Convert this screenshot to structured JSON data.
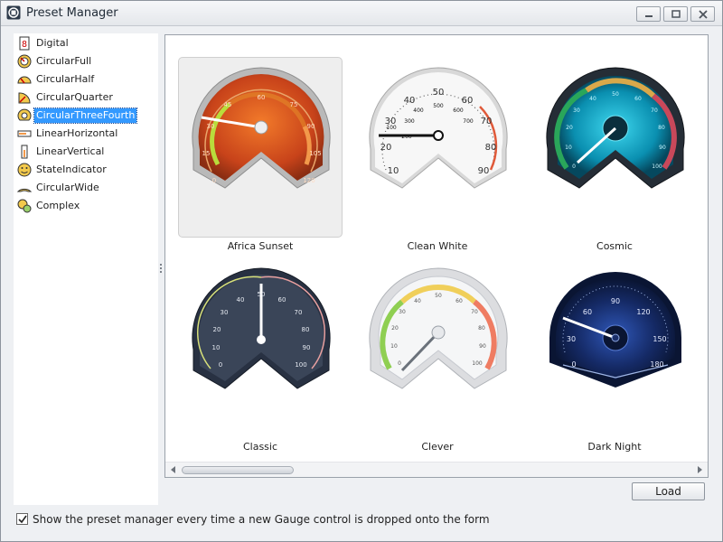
{
  "window": {
    "title": "Preset Manager"
  },
  "tree": {
    "selected": "CircularThreeFourth",
    "items": [
      {
        "label": "Digital",
        "icon": "digital-icon"
      },
      {
        "label": "CircularFull",
        "icon": "circular-full-icon"
      },
      {
        "label": "CircularHalf",
        "icon": "circular-half-icon"
      },
      {
        "label": "CircularQuarter",
        "icon": "circular-quarter-icon"
      },
      {
        "label": "CircularThreeFourth",
        "icon": "circular-three-fourth-icon"
      },
      {
        "label": "LinearHorizontal",
        "icon": "linear-horizontal-icon"
      },
      {
        "label": "LinearVertical",
        "icon": "linear-vertical-icon"
      },
      {
        "label": "StateIndicator",
        "icon": "state-indicator-icon"
      },
      {
        "label": "CircularWide",
        "icon": "circular-wide-icon"
      },
      {
        "label": "Complex",
        "icon": "complex-icon"
      }
    ]
  },
  "gallery": {
    "selected": "Africa Sunset",
    "presets": [
      {
        "name": "Africa Sunset",
        "scale": [
          "0",
          "15",
          "30",
          "45",
          "60",
          "75",
          "90",
          "105",
          "120"
        ]
      },
      {
        "name": "Clean White",
        "scale": [
          "10",
          "20",
          "30",
          "40",
          "50",
          "60",
          "70",
          "80",
          "90"
        ],
        "inner_scale": [
          "100",
          "200",
          "300",
          "400",
          "500",
          "600",
          "700"
        ]
      },
      {
        "name": "Cosmic",
        "scale": [
          "0",
          "10",
          "20",
          "30",
          "40",
          "50",
          "60",
          "70",
          "80",
          "90",
          "100"
        ]
      },
      {
        "name": "Classic",
        "scale": [
          "0",
          "10",
          "20",
          "30",
          "40",
          "50",
          "60",
          "70",
          "80",
          "90",
          "100"
        ]
      },
      {
        "name": "Clever",
        "scale": [
          "0",
          "10",
          "20",
          "30",
          "40",
          "50",
          "60",
          "70",
          "80",
          "90",
          "100"
        ]
      },
      {
        "name": "Dark Night",
        "scale": [
          "0",
          "30",
          "60",
          "90",
          "120",
          "150",
          "180"
        ]
      }
    ]
  },
  "buttons": {
    "load": "Load"
  },
  "footer": {
    "checkbox_checked": true,
    "label": "Show the preset manager every time a new Gauge control is dropped onto the form"
  }
}
